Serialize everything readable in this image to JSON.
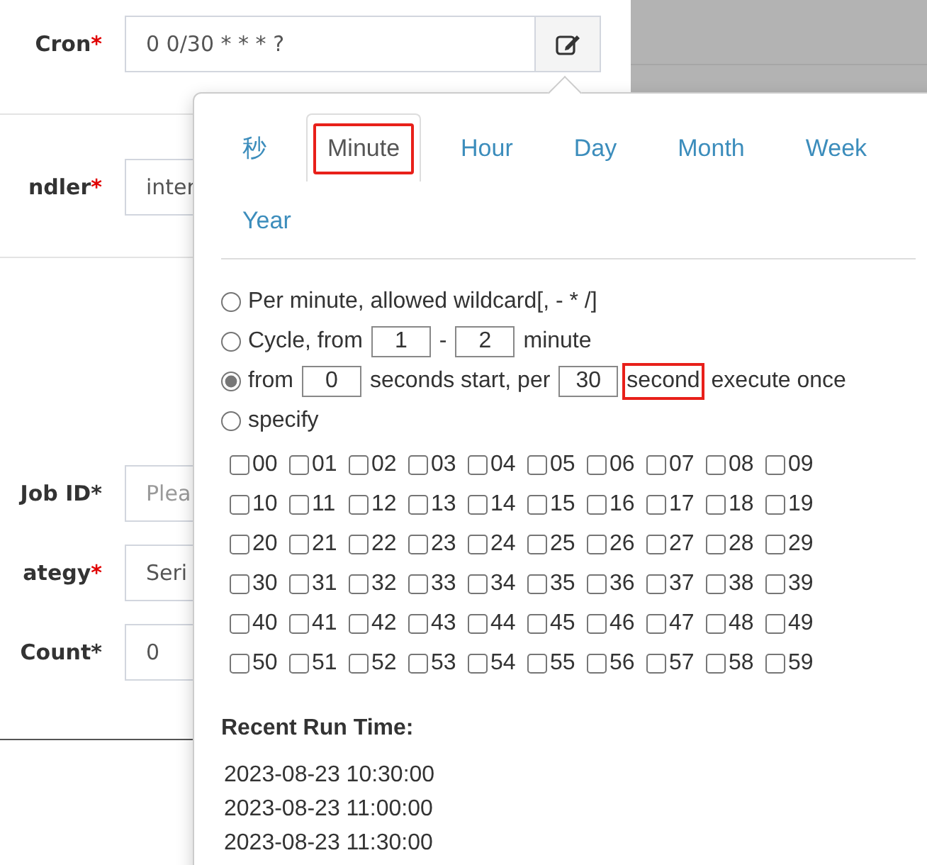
{
  "form": {
    "rows": [
      {
        "label": "Cron",
        "star": {
          "text": "*",
          "color": "#e00000"
        },
        "kind": "cron",
        "value": "0 0/30 * * * ?"
      },
      {
        "label": "ndler",
        "star": {
          "text": "*",
          "color": "#e00000"
        },
        "kind": "text",
        "value": "inter"
      },
      {
        "label": "Job ID",
        "star": {
          "text": "*",
          "color": "#333333"
        },
        "kind": "text",
        "placeholder": "Plea"
      },
      {
        "label": "ategy",
        "star": {
          "text": "*",
          "color": "#e00000"
        },
        "kind": "text",
        "value": "Seri"
      },
      {
        "label": "Count",
        "star": {
          "text": "*",
          "color": "#333333"
        },
        "kind": "text",
        "value": "0"
      }
    ]
  },
  "cron_popover": {
    "tabs": [
      {
        "label": "秒",
        "selected": false,
        "highlighted": false
      },
      {
        "label": "Minute",
        "selected": true,
        "highlighted": true
      },
      {
        "label": "Hour",
        "selected": false,
        "highlighted": false
      },
      {
        "label": "Day",
        "selected": false,
        "highlighted": false
      },
      {
        "label": "Month",
        "selected": false,
        "highlighted": false
      },
      {
        "label": "Week",
        "selected": false,
        "highlighted": false
      },
      {
        "label": "Year",
        "selected": false,
        "highlighted": false
      }
    ],
    "options": [
      {
        "selected": false,
        "segments": [
          {
            "kind": "text",
            "text": "Per minute, allowed wildcard[, - * /]"
          }
        ]
      },
      {
        "selected": false,
        "segments": [
          {
            "kind": "text",
            "text": "Cycle, from"
          },
          {
            "kind": "input",
            "value": "1"
          },
          {
            "kind": "text",
            "text": "-"
          },
          {
            "kind": "input",
            "value": "2"
          },
          {
            "kind": "text",
            "text": "minute"
          }
        ]
      },
      {
        "selected": true,
        "segments": [
          {
            "kind": "text",
            "text": "from"
          },
          {
            "kind": "input",
            "value": "0"
          },
          {
            "kind": "text",
            "text": "seconds start, per"
          },
          {
            "kind": "input",
            "value": "30"
          },
          {
            "kind": "text",
            "text": "second",
            "highlighted": true
          },
          {
            "kind": "text",
            "text": "execute once"
          }
        ]
      },
      {
        "selected": false,
        "segments": [
          {
            "kind": "text",
            "text": "specify"
          }
        ]
      }
    ],
    "minutes": [
      {
        "label": "00",
        "checked": false
      },
      {
        "label": "01",
        "checked": false
      },
      {
        "label": "02",
        "checked": false
      },
      {
        "label": "03",
        "checked": false
      },
      {
        "label": "04",
        "checked": false
      },
      {
        "label": "05",
        "checked": false
      },
      {
        "label": "06",
        "checked": false
      },
      {
        "label": "07",
        "checked": false
      },
      {
        "label": "08",
        "checked": false
      },
      {
        "label": "09",
        "checked": false
      },
      {
        "label": "10",
        "checked": false
      },
      {
        "label": "11",
        "checked": false
      },
      {
        "label": "12",
        "checked": false
      },
      {
        "label": "13",
        "checked": false
      },
      {
        "label": "14",
        "checked": false
      },
      {
        "label": "15",
        "checked": false
      },
      {
        "label": "16",
        "checked": false
      },
      {
        "label": "17",
        "checked": false
      },
      {
        "label": "18",
        "checked": false
      },
      {
        "label": "19",
        "checked": false
      },
      {
        "label": "20",
        "checked": false
      },
      {
        "label": "21",
        "checked": false
      },
      {
        "label": "22",
        "checked": false
      },
      {
        "label": "23",
        "checked": false
      },
      {
        "label": "24",
        "checked": false
      },
      {
        "label": "25",
        "checked": false
      },
      {
        "label": "26",
        "checked": false
      },
      {
        "label": "27",
        "checked": false
      },
      {
        "label": "28",
        "checked": false
      },
      {
        "label": "29",
        "checked": false
      },
      {
        "label": "30",
        "checked": false
      },
      {
        "label": "31",
        "checked": false
      },
      {
        "label": "32",
        "checked": false
      },
      {
        "label": "33",
        "checked": false
      },
      {
        "label": "34",
        "checked": false
      },
      {
        "label": "35",
        "checked": false
      },
      {
        "label": "36",
        "checked": false
      },
      {
        "label": "37",
        "checked": false
      },
      {
        "label": "38",
        "checked": false
      },
      {
        "label": "39",
        "checked": false
      },
      {
        "label": "40",
        "checked": false
      },
      {
        "label": "41",
        "checked": false
      },
      {
        "label": "42",
        "checked": false
      },
      {
        "label": "43",
        "checked": false
      },
      {
        "label": "44",
        "checked": false
      },
      {
        "label": "45",
        "checked": false
      },
      {
        "label": "46",
        "checked": false
      },
      {
        "label": "47",
        "checked": false
      },
      {
        "label": "48",
        "checked": false
      },
      {
        "label": "49",
        "checked": false
      },
      {
        "label": "50",
        "checked": false
      },
      {
        "label": "51",
        "checked": false
      },
      {
        "label": "52",
        "checked": false
      },
      {
        "label": "53",
        "checked": false
      },
      {
        "label": "54",
        "checked": false
      },
      {
        "label": "55",
        "checked": false
      },
      {
        "label": "56",
        "checked": false
      },
      {
        "label": "57",
        "checked": false
      },
      {
        "label": "58",
        "checked": false
      },
      {
        "label": "59",
        "checked": false
      }
    ],
    "recent_title": "Recent Run Time:",
    "recent_times": [
      "2023-08-23 10:30:00",
      "2023-08-23 11:00:00",
      "2023-08-23 11:30:00"
    ]
  }
}
